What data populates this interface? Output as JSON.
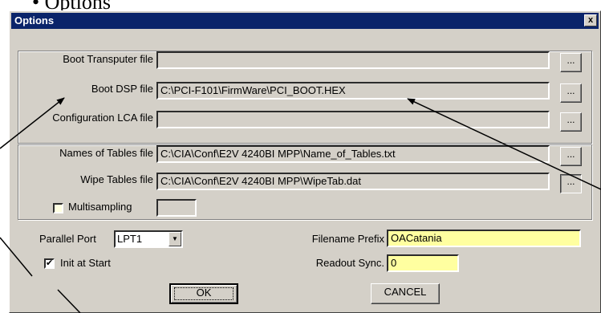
{
  "document": {
    "heading": "Options"
  },
  "dialog": {
    "title": "Options",
    "close_label": "x",
    "boot_transputer": {
      "label": "Boot Transputer file",
      "value": "",
      "browse_label": "..."
    },
    "boot_dsp": {
      "label": "Boot DSP file",
      "value": "C:\\PCI-F101\\FirmWare\\PCI_BOOT.HEX",
      "browse_label": "..."
    },
    "config_lca": {
      "label": "Configuration LCA file",
      "value": "",
      "browse_label": "..."
    },
    "names_tables": {
      "label": "Names of Tables file",
      "value": "C:\\CIA\\Conf\\E2V 4240BI MPP\\Name_of_Tables.txt",
      "browse_label": "..."
    },
    "wipe_tables": {
      "label": "Wipe Tables file",
      "value": "C:\\CIA\\Conf\\E2V 4240BI MPP\\WipeTab.dat",
      "browse_label": "..."
    },
    "multisampling": {
      "label": "Multisampling",
      "checked": false,
      "value": ""
    },
    "parallel_port": {
      "label": "Parallel Port",
      "value": "LPT1"
    },
    "init_at_start": {
      "label": "Init at Start",
      "checked": true,
      "mark": "✔"
    },
    "filename_prefix": {
      "label": "Filename Prefix",
      "value": "OACatania"
    },
    "readout_sync": {
      "label": "Readout Sync.",
      "value": "0"
    },
    "ok_label": "OK",
    "cancel_label": "CANCEL"
  },
  "colors": {
    "titlebar": "#0a246a",
    "dialog_bg": "#d4d0c8",
    "highlight_field": "#ffffe1"
  }
}
